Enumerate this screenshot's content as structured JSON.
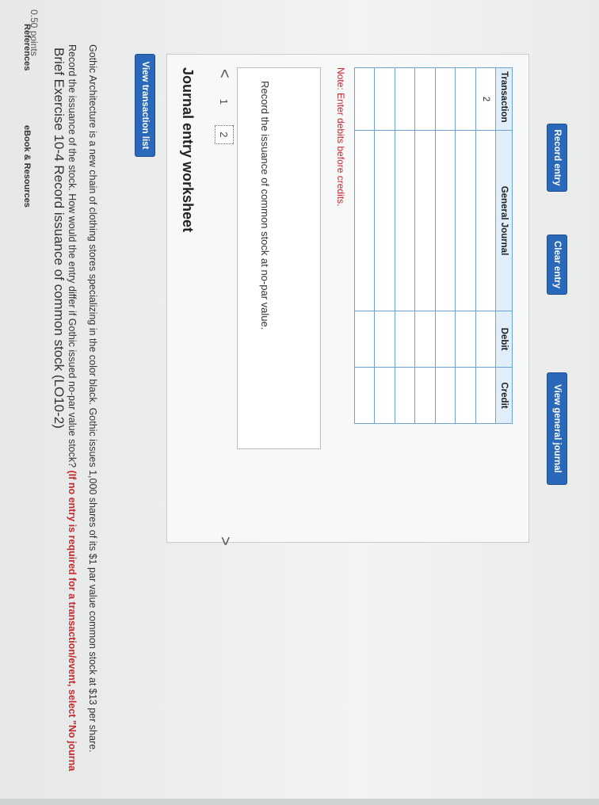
{
  "header": {
    "points": "0.50 points",
    "title": "Brief Exercise 10-4 Record issuance of common stock (LO10-2)",
    "prompt_line1": "Gothic Architecture is a new chain of clothing stores specializing in the color black. Gothic issues 1,000 shares of its $1 par value common stock at $13 per share.",
    "prompt_line2": "Record the issuance of the stock. How would the entry differ if Gothic issued no-par value stock?",
    "prompt_red": "(If no entry is required for a transaction/event, select \"No journa"
  },
  "buttons": {
    "view_transaction_list": "View transaction list",
    "record_entry": "Record entry",
    "clear_entry": "Clear entry",
    "view_general_journal": "View general journal"
  },
  "worksheet": {
    "title": "Journal entry worksheet",
    "prev_arrow": "<",
    "next_arrow": ">",
    "tabs": [
      "1",
      "2"
    ],
    "selected_tab": "2",
    "description": "Record the issuance of common stock at no-par value.",
    "note": "Note: Enter debits before credits."
  },
  "journal_table": {
    "headers": {
      "transaction": "Transaction",
      "account": "General Journal",
      "debit": "Debit",
      "credit": "Credit"
    },
    "first_transaction": "2",
    "row_count": 7
  },
  "footer": {
    "references": "References",
    "ebook": "eBook & Resources"
  }
}
